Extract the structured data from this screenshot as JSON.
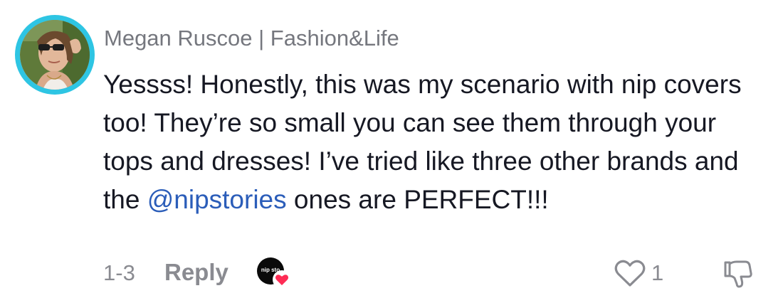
{
  "comment": {
    "username": "Megan Ruscoe | Fashion&Life",
    "text_part1": "Yessss! Honestly, this was my scenario with nip covers too! They’re so small you can see them through your tops and dresses! I’ve tried like three other brands and the ",
    "mention": "@nipstories",
    "text_part2": " ones are PERFECT!!!",
    "timestamp": "1-3",
    "reply_label": "Reply",
    "creator_avatar_text": "nip sto",
    "like_count": "1"
  },
  "colors": {
    "avatar_ring": "#2ec5e3",
    "mention": "#2b5db9",
    "creator_heart": "#fe2c55",
    "muted_text": "#8a8b91"
  },
  "icons": {
    "like": "heart-outline-icon",
    "dislike": "thumbs-down-outline-icon",
    "creator_liked": "heart-filled-icon"
  }
}
